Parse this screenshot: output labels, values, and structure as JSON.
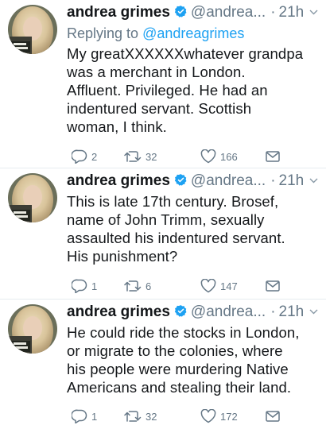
{
  "tweets": [
    {
      "author": {
        "name": "andrea grimes",
        "handle": "@andrea...",
        "time": "21h"
      },
      "reply_to_label": "Replying to",
      "reply_to_handle": "@andreagrimes",
      "lines": [
        "My greatXXXXXXwhatever grandpa",
        "was a merchant in London.",
        "Affluent. Privileged. He had an",
        "indentured servant. Scottish",
        "woman, I think."
      ],
      "counts": {
        "replies": "2",
        "retweets": "32",
        "likes": "166"
      }
    },
    {
      "author": {
        "name": "andrea grimes",
        "handle": "@andrea...",
        "time": "21h"
      },
      "lines": [
        "This is late 17th century. Brosef,",
        "name of John Trimm, sexually",
        "assaulted his indentured servant.",
        "His punishment?"
      ],
      "counts": {
        "replies": "1",
        "retweets": "6",
        "likes": "147"
      }
    },
    {
      "author": {
        "name": "andrea grimes",
        "handle": "@andrea...",
        "time": "21h"
      },
      "lines": [
        "He could ride the stocks in London,",
        "or migrate to the colonies, where",
        "his people were murdering Native",
        "Americans and stealing their land."
      ],
      "counts": {
        "replies": "1",
        "retweets": "32",
        "likes": "172"
      }
    }
  ],
  "separator": "·",
  "colors": {
    "accent": "#1da1f2",
    "muted": "#657786",
    "text": "#14171a",
    "divider": "#e6ecf0"
  },
  "icons": [
    "verified-badge-icon",
    "chevron-down-icon",
    "reply-icon",
    "retweet-icon",
    "like-heart-icon",
    "direct-message-icon"
  ]
}
